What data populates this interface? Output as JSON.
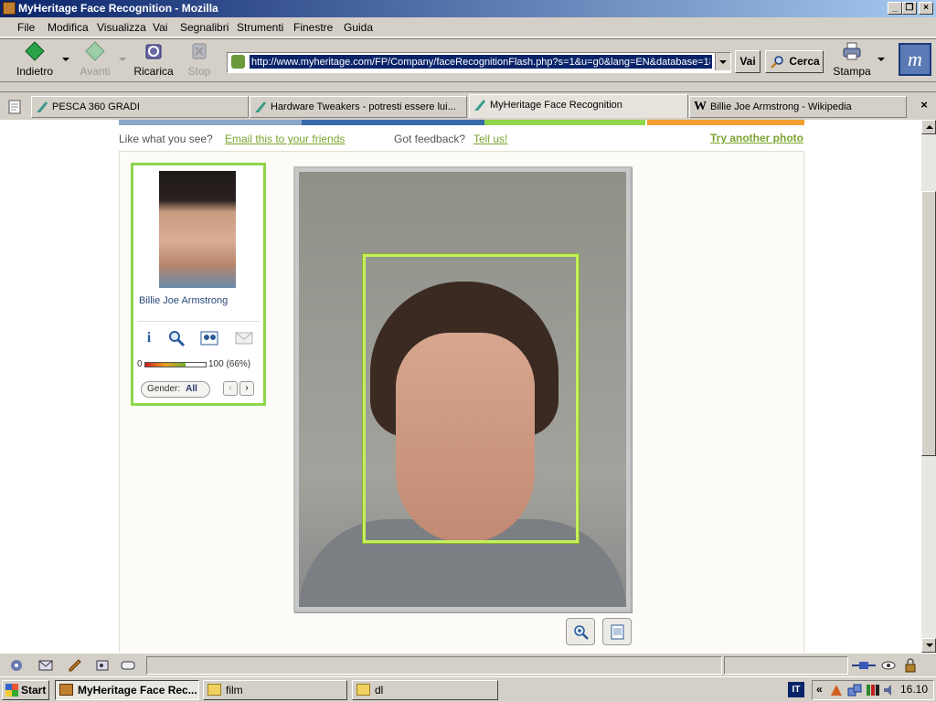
{
  "window": {
    "title": "MyHeritage Face Recognition - Mozilla",
    "caption_buttons": [
      "_",
      "❐",
      "×"
    ]
  },
  "menu": [
    "File",
    "Modifica",
    "Visualizza",
    "Vai",
    "Segnalibri",
    "Strumenti",
    "Finestre",
    "Guida"
  ],
  "toolbar": {
    "back": "Indietro",
    "forward": "Avanti",
    "reload": "Ricarica",
    "stop": "Stop",
    "url": "http://www.myheritage.com/FP/Company/faceRecognitionFlash.php?s=1&u=g0&lang=EN&database=18",
    "go": "Vai",
    "search": "Cerca",
    "print": "Stampa",
    "logo_letter": "m"
  },
  "tabs": [
    {
      "label": "PESCA 360 GRADI",
      "active": false
    },
    {
      "label": "Hardware Tweakers - potresti essere lui...",
      "active": false
    },
    {
      "label": "MyHeritage Face Recognition",
      "active": true
    },
    {
      "label": "Billie Joe Armstrong - Wikipedia",
      "active": false
    }
  ],
  "page": {
    "like_text": "Like what you see?",
    "email_link": "Email this to your friends",
    "feedback_text": "Got feedback?",
    "tell_link": "Tell us!",
    "try_link": "Try another photo",
    "match": {
      "name": "Billie Joe Armstrong",
      "scale_min": "0",
      "scale_max": "100 (66%)",
      "similarity": 0.66,
      "gender_label": "Gender:",
      "gender_value": "All",
      "prev": "‹",
      "next": "›"
    }
  },
  "taskbar": {
    "start": "Start",
    "tasks": [
      {
        "label": "MyHeritage Face Rec...",
        "active": true
      },
      {
        "label": "film",
        "active": false
      },
      {
        "label": "dl",
        "active": false
      }
    ],
    "lang": "IT",
    "tray_chevron": "«",
    "clock": "16.10"
  },
  "colors": {
    "accent_green": "#8ed64a",
    "link_green": "#7aa52e",
    "titlebar_dark": "#0a246a",
    "facebox": "#c4f05a"
  }
}
